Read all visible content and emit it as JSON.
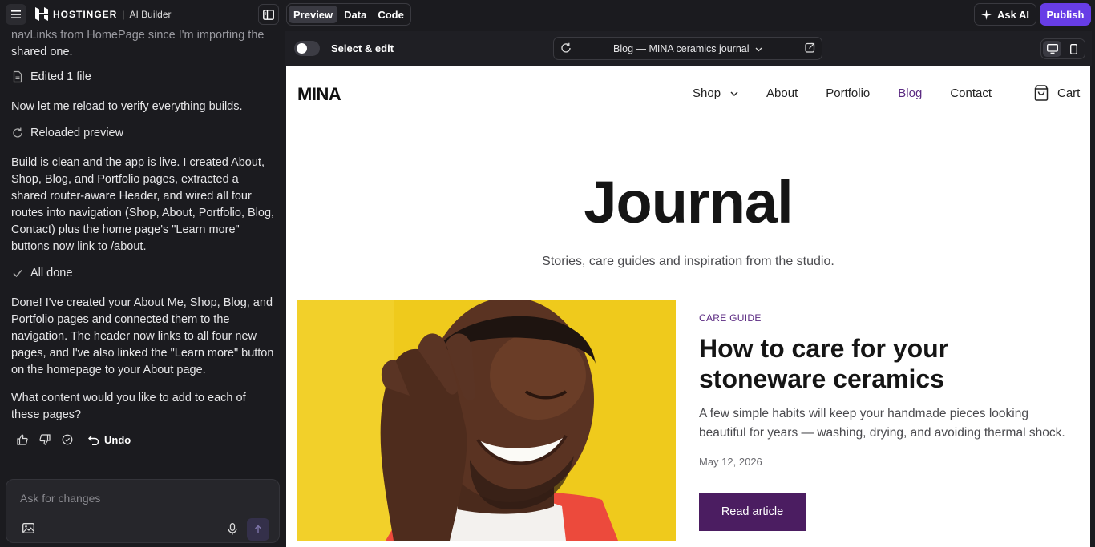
{
  "app": {
    "brand": "HOSTINGER",
    "product": "AI Builder",
    "view_tabs": [
      "Preview",
      "Data",
      "Code"
    ],
    "active_tab": "Preview",
    "ask_ai_label": "Ask AI",
    "publish_label": "Publish",
    "accent_color": "#673de6"
  },
  "chat": {
    "partial_line_1": "navLinks from HomePage since I'm importing the",
    "partial_line_2": "shared one.",
    "event_edited": "Edited 1 file",
    "msg_reload": "Now let me reload to verify everything builds.",
    "event_reloaded": "Reloaded preview",
    "msg_build": "Build is clean and the app is live. I created About, Shop, Blog, and Portfolio pages, extracted a shared router-aware Header, and wired all four routes into navigation (Shop, About, Portfolio, Blog, Contact) plus the home page's \"Learn more\" buttons now link to /about.",
    "event_done": "All done",
    "msg_done": "Done! I've created your About Me, Shop, Blog, and Portfolio pages and connected them to the navigation. The header now links to all four new pages, and I've also linked the \"Learn more\" button on the homepage to your About page.",
    "msg_question": "What content would you like to add to each of these pages?",
    "undo_label": "Undo",
    "composer_placeholder": "Ask for changes"
  },
  "preview": {
    "select_edit_label": "Select & edit",
    "url_label": "Blog — MINA ceramics journal"
  },
  "site": {
    "logo": "MINA",
    "nav": [
      {
        "label": "Shop",
        "dropdown": true,
        "active": false
      },
      {
        "label": "About",
        "dropdown": false,
        "active": false
      },
      {
        "label": "Portfolio",
        "dropdown": false,
        "active": false
      },
      {
        "label": "Blog",
        "dropdown": false,
        "active": true
      },
      {
        "label": "Contact",
        "dropdown": false,
        "active": false
      }
    ],
    "cart_label": "Cart",
    "hero_title": "Journal",
    "hero_subtitle": "Stories, care guides and inspiration from the studio.",
    "featured": {
      "tag": "CARE GUIDE",
      "title": "How to care for your stoneware ceramics",
      "excerpt": "A few simple habits will keep your handmade pieces looking beautiful for years — washing, drying, and avoiding thermal shock.",
      "date": "May 12, 2026",
      "cta": "Read article"
    },
    "brand_color": "#4b1d61"
  }
}
